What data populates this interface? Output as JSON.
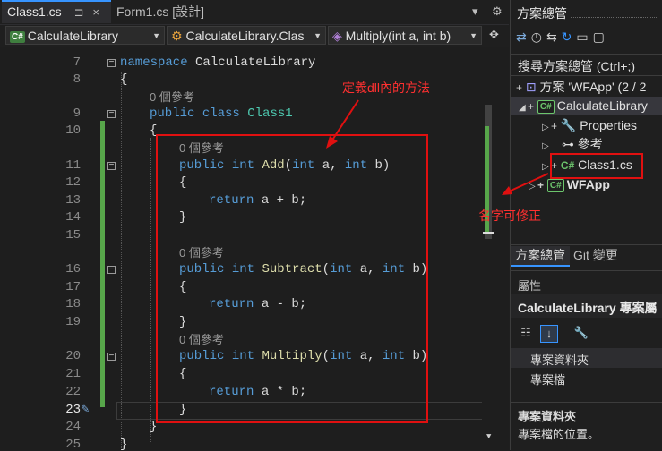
{
  "tabs": [
    {
      "label": "Class1.cs",
      "active": true
    },
    {
      "label": "Form1.cs [設計]",
      "active": false
    }
  ],
  "tabbar_glyphs": {
    "pin": "⊐",
    "close": "×",
    "dropdown": "▾",
    "settings": "⚙"
  },
  "navbar": {
    "project": "CalculateLibrary",
    "class": "CalculateLibrary.Clas",
    "member": "Multiply(int a, int b)"
  },
  "code_lines": [
    {
      "n": "7",
      "code": "namespace CalculateLibrary"
    },
    {
      "n": "8",
      "code": "{"
    },
    {
      "ref": "0 個參考"
    },
    {
      "n": "9",
      "code": "public class Class1"
    },
    {
      "n": "10",
      "code": "{"
    },
    {
      "ref": "0 個參考"
    },
    {
      "n": "11",
      "code": "public int Add(int a, int b)"
    },
    {
      "n": "12",
      "code": "{"
    },
    {
      "n": "13",
      "code": "return a + b;"
    },
    {
      "n": "14",
      "code": "}"
    },
    {
      "n": "15",
      "code": ""
    },
    {
      "ref": "0 個參考"
    },
    {
      "n": "16",
      "code": "public int Subtract(int a, int b)"
    },
    {
      "n": "17",
      "code": "{"
    },
    {
      "n": "18",
      "code": "return a - b;"
    },
    {
      "n": "19",
      "code": "}"
    },
    {
      "ref": "0 個參考"
    },
    {
      "n": "20",
      "code": "public int Multiply(int a, int b)"
    },
    {
      "n": "21",
      "code": "{"
    },
    {
      "n": "22",
      "code": "return a * b;"
    },
    {
      "n": "23",
      "code": "}"
    },
    {
      "n": "24",
      "code": "}"
    },
    {
      "n": "25",
      "code": "}"
    }
  ],
  "annotations": {
    "method_note": "定義dll內的方法",
    "rename_note": "名字可修正"
  },
  "solution_explorer": {
    "title": "方案總管",
    "search_placeholder": "搜尋方案總管 (Ctrl+;)",
    "solution_label": "方案 'WFApp' (2 / 2",
    "items": [
      {
        "label": "CalculateLibrary",
        "icon": "csharp-project-icon"
      },
      {
        "label": "Properties",
        "icon": "wrench-icon"
      },
      {
        "label": "參考",
        "icon": "references-icon"
      },
      {
        "label": "Class1.cs",
        "icon": "csharp-file-icon"
      },
      {
        "label": "WFApp",
        "icon": "csharp-project-icon"
      }
    ],
    "bottom_tabs": [
      "方案總管",
      "Git 變更"
    ]
  },
  "properties": {
    "title": "屬性",
    "object": "CalculateLibrary 專案屬",
    "rows": [
      "專案資料夾",
      "專案檔"
    ],
    "desc_title": "專案資料夾",
    "desc_text": "專案檔的位置。"
  },
  "colors": {
    "accent": "#3794ff",
    "annotation": "#e01010",
    "keyword": "#569cd6",
    "type": "#4ec9b0",
    "method": "#dcdcaa",
    "change_bar": "#57a64a"
  }
}
